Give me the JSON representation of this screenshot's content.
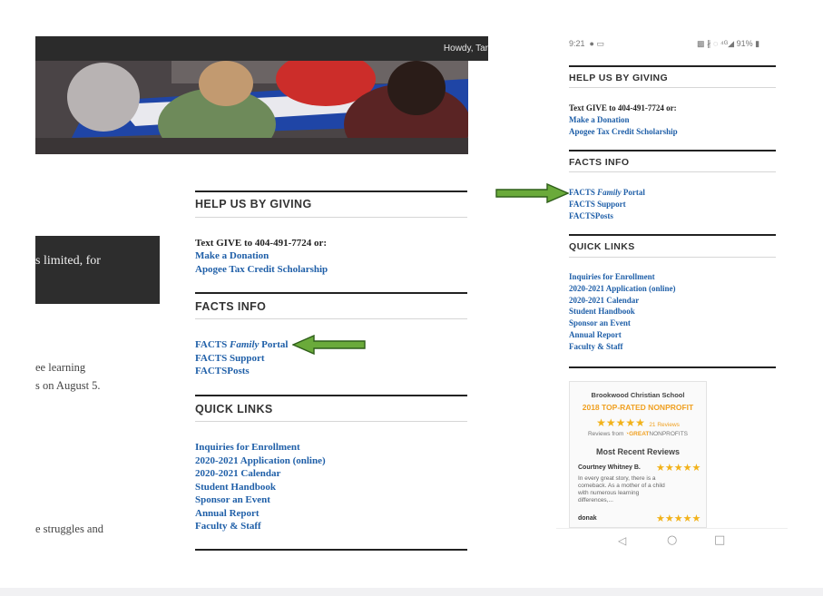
{
  "desktop": {
    "admin_greeting": "Howdy, Tar",
    "dark_box_text": "s limited, for",
    "fragments": [
      "ee learning",
      "s on August 5.",
      "e struggles and"
    ],
    "giving": {
      "heading": "HELP US BY GIVING",
      "text": "Text GIVE to 404-491-7724 or:",
      "links": [
        "Make a Donation",
        "Apogee Tax Credit Scholarship"
      ]
    },
    "facts": {
      "heading": "FACTS INFO",
      "link1_prefix": "FACTS ",
      "link1_italic": "Family",
      "link1_suffix": " Portal",
      "links": [
        "FACTS Support",
        "FACTSPosts"
      ]
    },
    "quick": {
      "heading": "QUICK LINKS",
      "links": [
        "Inquiries for Enrollment",
        "2020-2021 Application (online)",
        "2020-2021 Calendar",
        "Student Handbook",
        "Sponsor an Event",
        "Annual Report",
        "Faculty & Staff"
      ]
    }
  },
  "mobile": {
    "status_time": "9:21",
    "status_right": "91%",
    "giving": {
      "heading": "HELP US BY GIVING",
      "text": "Text GIVE to 404-491-7724 or:",
      "links": [
        "Make a Donation",
        "Apogee Tax Credit Scholarship"
      ]
    },
    "facts": {
      "heading": "FACTS INFO",
      "link1_prefix": "FACTS ",
      "link1_italic": "Family",
      "link1_suffix": " Portal",
      "links": [
        "FACTS Support",
        "FACTSPosts"
      ]
    },
    "quick": {
      "heading": "QUICK LINKS",
      "links": [
        "Inquiries for Enrollment",
        "2020-2021 Application (online)",
        "2020-2021 Calendar",
        "Student Handbook",
        "Sponsor an Event",
        "Annual Report",
        "Faculty & Staff"
      ]
    },
    "badge": {
      "school": "Brookwood Christian School",
      "award": "2018 TOP-RATED NONPROFIT",
      "reviews_count": "21 Reviews",
      "source_prefix": "Reviews from ",
      "source_brand": "GREAT",
      "source_suffix": "NONPROFITS",
      "recent_heading": "Most Recent Reviews",
      "reviewer1": "Courtney Whitney B.",
      "review1_text": [
        "In every great story, there is a",
        "comeback. As a mother of a child",
        "with numerous learning",
        "differences,..."
      ],
      "reviewer2": "donak",
      "stars": "★★★★★"
    },
    "nav": {
      "back": "◁",
      "home": "○",
      "recent": "□"
    }
  },
  "colors": {
    "link": "#1f5fa8",
    "arrow": "#6aaa3a",
    "arrow_outline": "#2f5f1a",
    "heading_rule": "#222222"
  }
}
